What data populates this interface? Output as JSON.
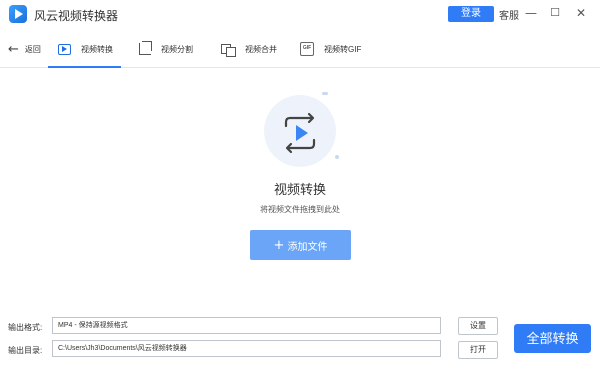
{
  "titlebar": {
    "app_title": "风云视频转换器",
    "login_label": "登录",
    "service_label": "客服",
    "minimize_glyph": "—",
    "maximize_glyph": "☐",
    "close_glyph": "✕"
  },
  "nav": {
    "back_label": "返回",
    "tabs": [
      {
        "label": "视频转换",
        "icon": "video-convert-icon",
        "active": true
      },
      {
        "label": "视频分割",
        "icon": "crop-icon",
        "active": false
      },
      {
        "label": "视频合并",
        "icon": "merge-icon",
        "active": false
      },
      {
        "label": "视频转GIF",
        "icon": "gif-icon",
        "active": false
      }
    ]
  },
  "main": {
    "title": "视频转换",
    "subtitle": "将视频文件拖拽到此处",
    "add_button_label": "添加文件",
    "add_button_icon": "plus-icon"
  },
  "output": {
    "format_label": "输出格式:",
    "format_value": "MP4 - 保持源视频格式",
    "settings_button": "设置",
    "dir_label": "输出目录:",
    "dir_value": "C:\\Users\\Jh3\\Documents\\风云视频转换器",
    "open_button": "打开",
    "convert_all_button": "全部转换"
  },
  "colors": {
    "accent": "#2f7cf6",
    "add_button": "#6aa5f7",
    "hero_bg": "#eef3fb"
  }
}
